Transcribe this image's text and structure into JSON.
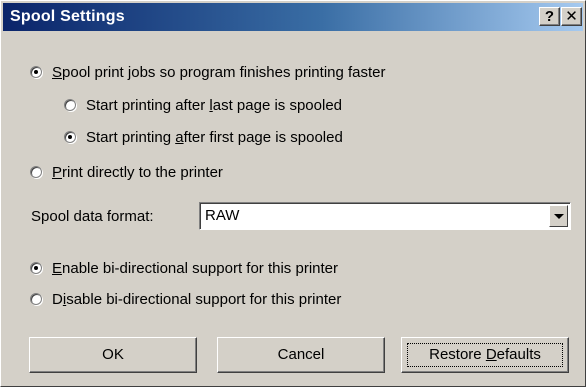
{
  "dialog": {
    "title": "Spool Settings",
    "help_button": "?",
    "close_button": "✕"
  },
  "options": {
    "spool": {
      "pre": "",
      "key": "S",
      "post": "pool print jobs so program finishes printing faster",
      "checked": true
    },
    "after_last": {
      "pre": "Start printing after ",
      "key": "l",
      "post": "ast page is spooled",
      "checked": false
    },
    "after_first": {
      "pre": "Start printing ",
      "key": "a",
      "post": "fter first page is spooled",
      "checked": true
    },
    "direct": {
      "pre": "",
      "key": "P",
      "post": "rint directly to the printer",
      "checked": false
    },
    "enable_bidi": {
      "pre": "",
      "key": "E",
      "post": "nable bi-directional support for this printer",
      "checked": true
    },
    "disable_bidi": {
      "pre": "D",
      "key": "i",
      "post": "sable bi-directional support for this printer",
      "checked": false
    }
  },
  "format": {
    "label": "Spool data format:",
    "value": "RAW"
  },
  "buttons": {
    "ok": "OK",
    "cancel": "Cancel",
    "restore": {
      "pre": "Restore ",
      "key": "D",
      "post": "efaults"
    }
  }
}
